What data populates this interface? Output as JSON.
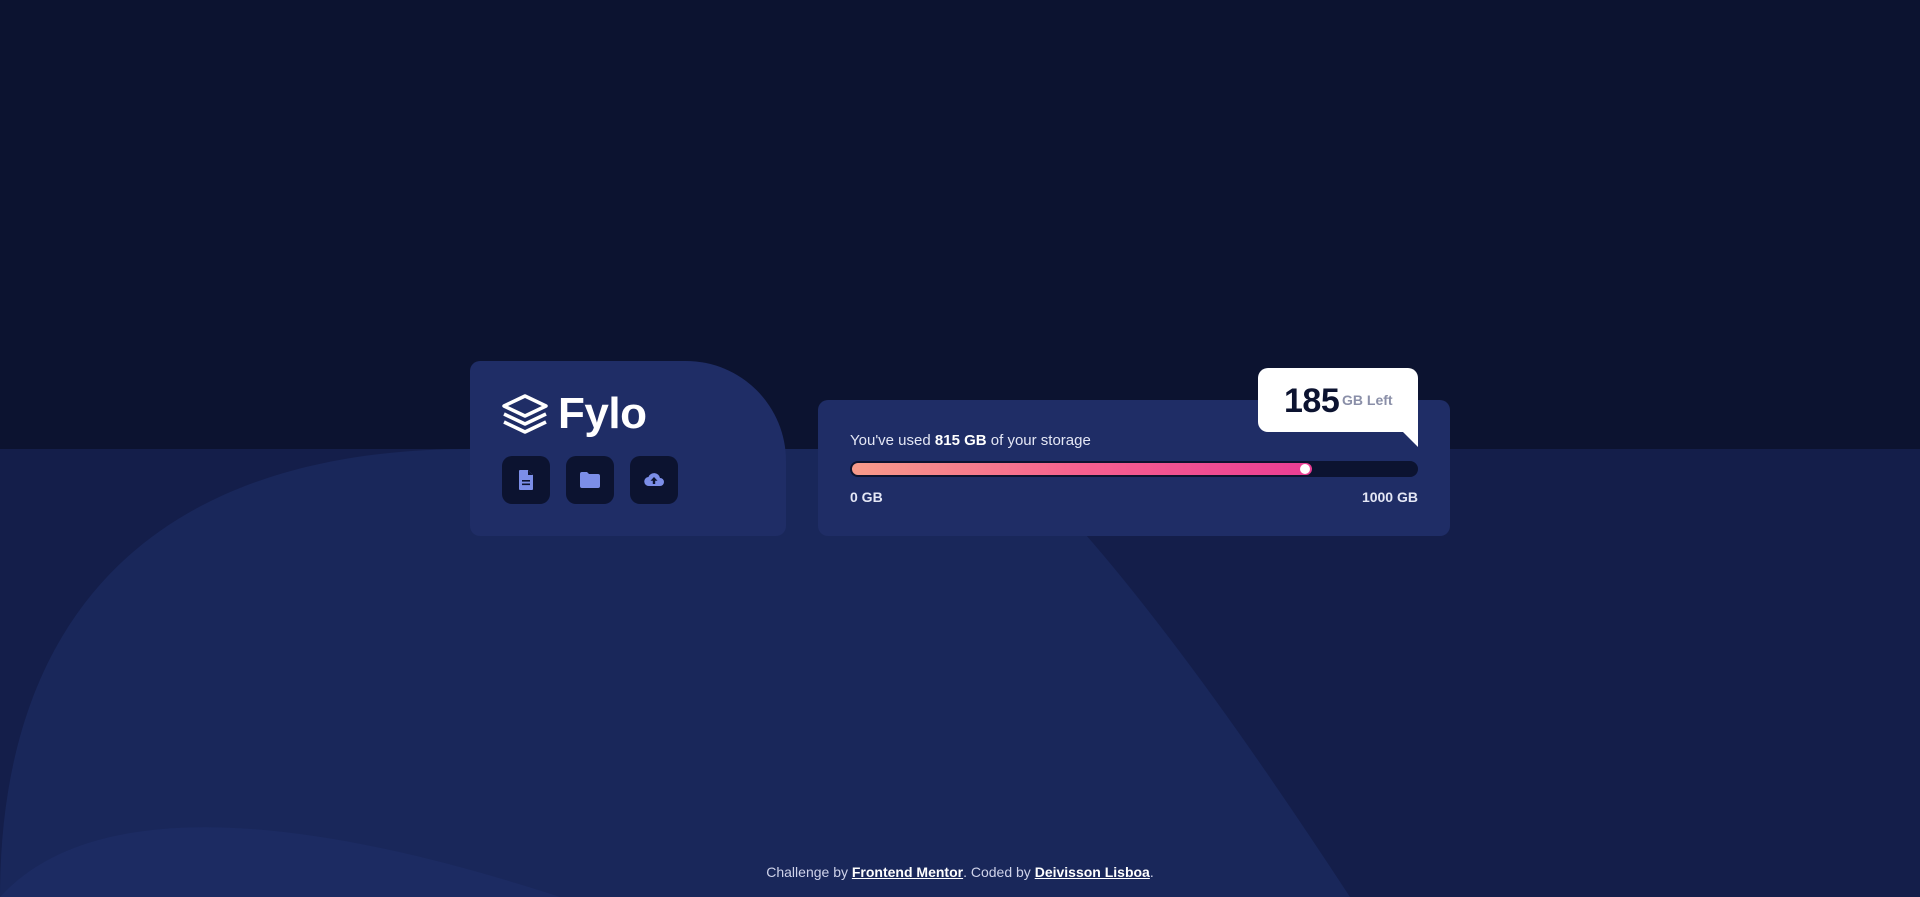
{
  "brand": {
    "name": "Fylo"
  },
  "actions": [
    {
      "icon": "document-icon",
      "label": "File"
    },
    {
      "icon": "folder-icon",
      "label": "Folder"
    },
    {
      "icon": "upload-cloud-icon",
      "label": "Upload"
    }
  ],
  "storage": {
    "used_prefix": "You've used ",
    "used_value": "815 GB",
    "used_suffix": " of your storage",
    "min_label": "0 GB",
    "max_label": "1000 GB",
    "used_fraction": 0.815,
    "remaining_amount": "185",
    "remaining_unit": "GB Left"
  },
  "footer": {
    "prefix": "Challenge by ",
    "challenge_link": "Frontend Mentor",
    "middle": ". Coded by ",
    "author_link": "Deivisson Lisboa",
    "suffix": "."
  },
  "colors": {
    "background": "#0c1330",
    "card": "#1f2d66",
    "icon_accent": "#7c8ee8",
    "gradient_start": "#f79b8a",
    "gradient_end": "#e93d94"
  }
}
